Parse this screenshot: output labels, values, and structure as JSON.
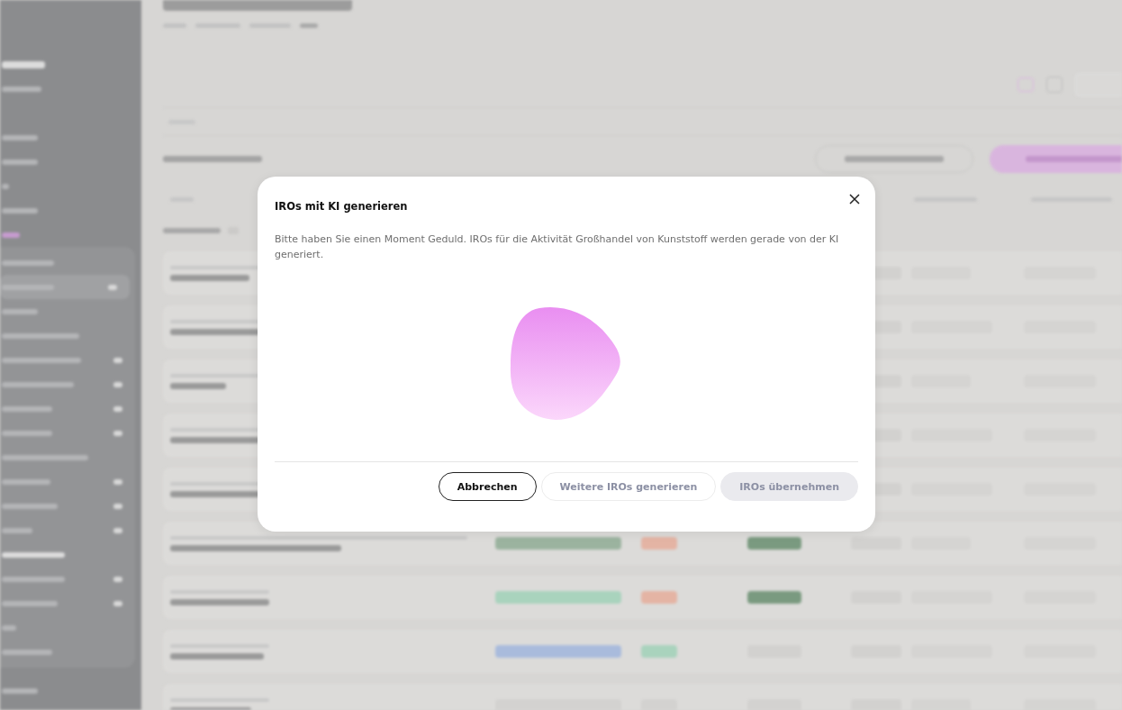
{
  "modal": {
    "title": "IROs mit KI generieren",
    "message": "Bitte haben Sie einen Moment Geduld. IROs für die Aktivität Großhandel von Kunststoff werden gerade von der KI generiert.",
    "buttons": [
      {
        "label": "Abbrechen",
        "kind": "outline",
        "disabled": false
      },
      {
        "label": "Weitere IROs generieren",
        "kind": "outline",
        "disabled": true
      },
      {
        "label": "IROs übernehmen",
        "kind": "filled",
        "disabled": true
      }
    ]
  }
}
